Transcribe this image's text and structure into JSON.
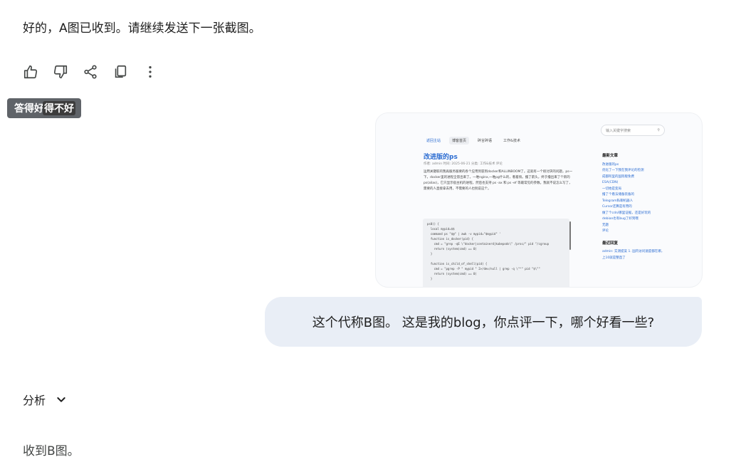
{
  "reply_top": "好的，A图已收到。请继续发送下一张截图。",
  "actions": {
    "icons": [
      "thumbs-up-icon",
      "thumbs-down-icon",
      "share-icon",
      "copy-icon",
      "more-vert-icon"
    ]
  },
  "tooltip": {
    "text_a": "答得好",
    "text_b": "得不好"
  },
  "screenshot": {
    "nav": [
      "返回主站",
      "博客首页",
      "碎言碎语",
      "工作&技术"
    ],
    "search_placeholder": "输入关键字搜索",
    "post_title": "改进版的ps",
    "meta": "作者: admin  时间: 2025-06-21  分类: 工作&技术  评论",
    "body": "运用关键取的我再服务服要的各个应用到容到docker和ALLINBOOM了。这就有一个很讨厌的问题，ps一下，docker里的进程全冒出来了。一堆nginx,一堆pg什么的，看着烦。撸了箭头，终于撸出来了个新的ps(alias)，它只显示宿主机的进程，然后也支持 ps -ax 和 ps -ef 等最常见的参数。我就不说怎么写了，需要的人直接拿去用，不需要的人也别说这个。",
    "code": "ps0() {\n  local mypid=$$\n  command ps \"$@\" | awk -v mypid=\"$mypid\" '\n  function is_docker(pid) {\n    cmd = \"grep -qE \\\"docker|containerd|kubepods\\\" /proc/\" pid \"/cgroup\n    return (system(cmd) == 0)\n  }\n\n  function is_child_of_shell(pid) {\n    cmd = \"pgrep -P \" mypid \" 2>/dev/null | grep -q \\\"^\" pid \"$\\\"\"\n    return (system(cmd) == 0)\n  }",
    "sidebar_title": "最新文章",
    "sidebar_links": [
      "改进版的ps",
      "优化了一下我在我评论的检测",
      "成都阿里的国际版免费",
      "ESA(CDN)",
      "一切始是变局",
      "撸了个看法储备装备的",
      "Telegram私聊机器人",
      "Cursor还算是有用的",
      "做了个cdn/哪里证据，还是好玩的",
      "debian也有bug了好到哦",
      "无题",
      "评论"
    ],
    "sidebar_title2": "最近回复",
    "sidebar_reply": "admin: 实测提案 1. 国内访问速度都在哪，上10就是整直了"
  },
  "user_message": "这个代称B图。 这是我的blog，你点评一下，哪个好看一些?",
  "analysis_label": "分析",
  "final_text": "收到B图。"
}
